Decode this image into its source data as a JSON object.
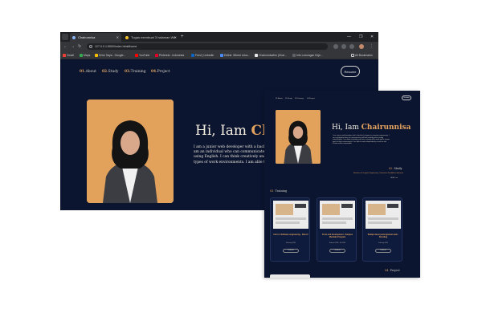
{
  "browser": {
    "tabs": [
      {
        "label": "Chairunnisa",
        "active": true
      },
      {
        "label": "Tugas membuat 3 halaman We",
        "active": false
      }
    ],
    "url": "127.0.0.1:5500/index.html#home",
    "bookmarks": [
      "Gmail",
      "Maps",
      "Drive Saya - Google...",
      "YouTube",
      "Pinterest - Indonesia",
      "Feed | LinkedIn",
      "Edlink: Where educ...",
      "Chairunnisafirn (Chai...",
      "Info Lowongan Keje...",
      "All Bookmarks"
    ],
    "colors": {
      "frame": "#202124",
      "toolbar": "#35363a"
    }
  },
  "site": {
    "nav": [
      {
        "num": "01.",
        "label": "About"
      },
      {
        "num": "02.",
        "label": "Study"
      },
      {
        "num": "03.",
        "label": "Training"
      },
      {
        "num": "04.",
        "label": "Project"
      }
    ],
    "resume_label": "Resume",
    "hero": {
      "greeting": "Hi, Iam ",
      "name": "Chairunnisa",
      "name_visible": "Ch",
      "description_lines": [
        "I am a junior web developer with a bachelo",
        "am an individual who can communicate we",
        "using English. I can think creatively and ha",
        "types of work environments. I am able to wor"
      ]
    },
    "colors": {
      "background": "#0b1530",
      "accent": "#e4a35e",
      "photo_bg": "#e3a25c",
      "text": "#f2ecdf"
    }
  },
  "preview": {
    "nav": [
      "01.About",
      "02.Study",
      "03.Training",
      "04.Project"
    ],
    "resume_label": "Resume",
    "hero_greeting": "Hi, Iam ",
    "hero_name": "Chairunnisa",
    "description_lines": [
      "I am a junior web developer with a bachelor's degree in computer engineering. I",
      "am an individual who can communicate well both verbally and in writing",
      "using English. I can think creatively and have a strong will to work well in various",
      "types of work environments. I am able to work independently as well as with",
      "a team and be responsible."
    ],
    "study": {
      "num": "02.",
      "label": "Study",
      "detail": "Bachelor of Computer Engineering - Universitas Pendidikan Indonesia",
      "gpa": "GPA: 3.xx"
    },
    "training": {
      "num": "03.",
      "label": "Training",
      "cards": [
        {
          "title": "Intro to Software engineering - RevoU",
          "date": "February 2024",
          "button": "Certificate"
        },
        {
          "title": "Front-end development - Kampus Merdeka Program",
          "date": "Februari 2024 - Juli 2024",
          "button": "Certificate"
        },
        {
          "title": "Belajar dasar pemrograman web - Dicoding",
          "date": "February 2024",
          "button": "Certificate"
        }
      ]
    },
    "project": {
      "num": "04.",
      "label": "Project"
    }
  }
}
